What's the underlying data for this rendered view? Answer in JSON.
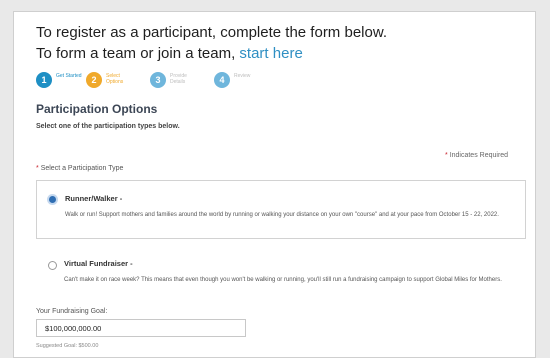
{
  "header": {
    "line1": "To register as a participant, complete the form below.",
    "line2_prefix": "To form a team or join a team, ",
    "line2_link": "start here"
  },
  "steps": [
    {
      "number": "1",
      "label": "Get Started",
      "color": "#1e8fc4",
      "active": true
    },
    {
      "number": "2",
      "label": "Select Options",
      "color": "#f0a92b",
      "active": true
    },
    {
      "number": "3",
      "label": "Provide Details",
      "color": "#6fb6dc",
      "active": false
    },
    {
      "number": "4",
      "label": "Review",
      "color": "#6fb6dc",
      "active": false
    }
  ],
  "section": {
    "title": "Participation Options",
    "subtitle": "Select one of the participation types below."
  },
  "required_note": {
    "star": "*",
    "text": "Indicates Required"
  },
  "type_field": {
    "star": "*",
    "label": "Select a Participation Type"
  },
  "options": [
    {
      "title": "Runner/Walker -",
      "desc": "Walk or run! Support mothers and families around the world by running or walking your distance on your own \"course\" and at your pace from October 15 - 22, 2022.",
      "selected": true
    },
    {
      "title": "Virtual Fundraiser -",
      "desc": "Can't make it on race week? This means that even though you won't be walking or running, you'll still run a fundraising campaign to support Global Miles for Mothers.",
      "selected": false
    }
  ],
  "goal": {
    "label": "Your Fundraising Goal:",
    "value": "$100,000,000.00",
    "suggested": "Suggested Goal: $500.00"
  },
  "colors": {
    "accent": "#2f8fc3",
    "required": "#c9232d",
    "title": "#3c4655"
  }
}
